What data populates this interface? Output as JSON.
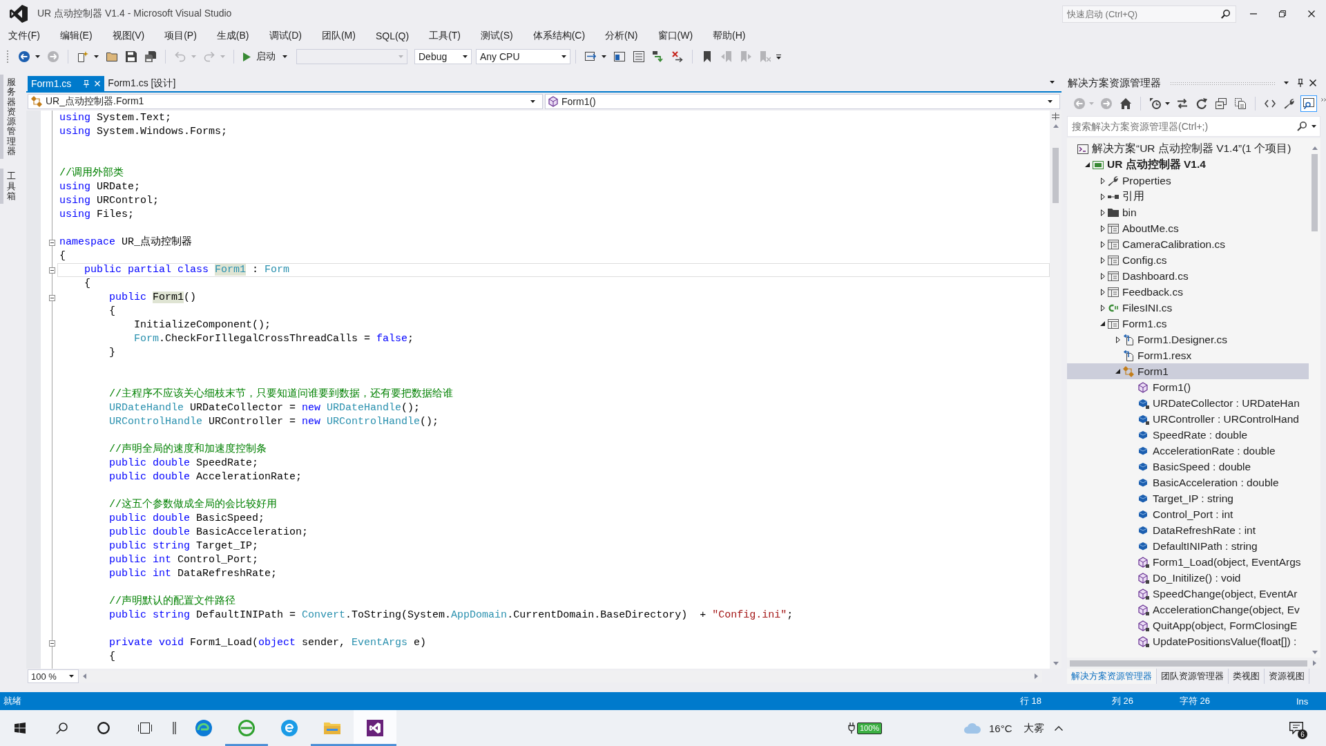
{
  "title_bar": {
    "title": "UR 点动控制器 V1.4 - Microsoft Visual Studio",
    "quick_launch": {
      "placeholder": "快速启动 (Ctrl+Q)"
    }
  },
  "menu": [
    "文件(F)",
    "编辑(E)",
    "视图(V)",
    "项目(P)",
    "生成(B)",
    "调试(D)",
    "团队(M)",
    "SQL(Q)",
    "工具(T)",
    "测试(S)",
    "体系结构(C)",
    "分析(N)",
    "窗口(W)",
    "帮助(H)"
  ],
  "toolbar": {
    "navigation_buttons": [
      {
        "kind": "back",
        "disabled": false
      },
      {
        "kind": "forward",
        "disabled": true
      }
    ],
    "file_buttons": [
      {
        "kind": "newproject",
        "disabled": false
      },
      {
        "kind": "open",
        "disabled": false
      },
      {
        "kind": "save",
        "disabled": false
      },
      {
        "kind": "saveall",
        "disabled": false
      }
    ],
    "edit_buttons": [
      {
        "kind": "undo",
        "disabled": true
      },
      {
        "kind": "redo",
        "disabled": true
      }
    ],
    "start_button": "启动",
    "configuration": "Debug",
    "platform": "Any CPU",
    "debug_buttons": [
      {
        "kind": "attach",
        "disabled": false
      },
      {
        "kind": "panel",
        "disabled": false
      },
      {
        "kind": "list",
        "disabled": false
      },
      {
        "kind": "stepin",
        "disabled": false
      },
      {
        "kind": "stepout",
        "disabled": false
      }
    ],
    "bookmark_buttons": [
      {
        "kind": "bookmark",
        "disabled": false
      },
      {
        "kind": "prevbookmark",
        "disabled": true
      },
      {
        "kind": "nextbookmark",
        "disabled": true
      },
      {
        "kind": "clearbookmark",
        "disabled": true
      }
    ]
  },
  "side_tabs": [
    "服务器资源管理器",
    "工具箱"
  ],
  "editor": {
    "tabs": [
      {
        "label": "Form1.cs",
        "selected": true
      },
      {
        "label": "Form1.cs [设计]",
        "selected": false
      }
    ],
    "type_dropdown": "UR_点动控制器.Form1",
    "member_dropdown": "Form1()",
    "lines": [
      {
        "fold": false,
        "current": false,
        "tokens": [
          {
            "text": "using",
            "kind": "keyword"
          },
          {
            "text": " System.Text;",
            "kind": "plain"
          }
        ]
      },
      {
        "fold": false,
        "current": false,
        "tokens": [
          {
            "text": "using",
            "kind": "keyword"
          },
          {
            "text": " System.Windows.Forms;",
            "kind": "plain"
          }
        ]
      },
      {
        "fold": false,
        "current": false
      },
      {
        "fold": false,
        "current": false
      },
      {
        "fold": false,
        "current": false,
        "tokens": [
          {
            "text": "//调用外部类",
            "kind": "comment"
          }
        ]
      },
      {
        "fold": false,
        "current": false,
        "tokens": [
          {
            "text": "using",
            "kind": "keyword"
          },
          {
            "text": " URDate;",
            "kind": "plain"
          }
        ]
      },
      {
        "fold": false,
        "current": false,
        "tokens": [
          {
            "text": "using",
            "kind": "keyword"
          },
          {
            "text": " URControl;",
            "kind": "plain"
          }
        ]
      },
      {
        "fold": false,
        "current": false,
        "tokens": [
          {
            "text": "using",
            "kind": "keyword"
          },
          {
            "text": " Files;",
            "kind": "plain"
          }
        ]
      },
      {
        "fold": false,
        "current": false
      },
      {
        "fold": true,
        "current": false,
        "tokens": [
          {
            "text": "namespace",
            "kind": "keyword"
          },
          {
            "text": " UR_点动控制器",
            "kind": "plain"
          }
        ]
      },
      {
        "fold": false,
        "current": false,
        "tokens": [
          {
            "text": "{",
            "kind": "plain"
          }
        ]
      },
      {
        "fold": true,
        "current": true,
        "tokens": [
          {
            "text": "    public partial class ",
            "kind": "keyword"
          },
          {
            "text": "Form1",
            "kind": "typematch"
          },
          {
            "text": " : ",
            "kind": "plain"
          },
          {
            "text": "Form",
            "kind": "type"
          }
        ]
      },
      {
        "fold": false,
        "current": false,
        "tokens": [
          {
            "text": "    {",
            "kind": "plain"
          }
        ]
      },
      {
        "fold": true,
        "current": false,
        "tokens": [
          {
            "text": "        public ",
            "kind": "keyword"
          },
          {
            "text": "Form1",
            "kind": "match"
          },
          {
            "text": "()",
            "kind": "plain"
          }
        ]
      },
      {
        "fold": false,
        "current": false,
        "tokens": [
          {
            "text": "        {",
            "kind": "plain"
          }
        ]
      },
      {
        "fold": false,
        "current": false,
        "tokens": [
          {
            "text": "            InitializeComponent();",
            "kind": "plain"
          }
        ]
      },
      {
        "fold": false,
        "current": false,
        "tokens": [
          {
            "text": "            Form",
            "kind": "type"
          },
          {
            "text": ".CheckForIllegalCrossThreadCalls = ",
            "kind": "plain"
          },
          {
            "text": "false",
            "kind": "keyword"
          },
          {
            "text": ";",
            "kind": "plain"
          }
        ]
      },
      {
        "fold": false,
        "current": false,
        "tokens": [
          {
            "text": "        }",
            "kind": "plain"
          }
        ]
      },
      {
        "fold": false,
        "current": false
      },
      {
        "fold": false,
        "current": false
      },
      {
        "fold": false,
        "current": false,
        "tokens": [
          {
            "text": "        //主程序不应该关心细枝末节，只要知道问谁要到数据，还有要把数据给谁",
            "kind": "comment"
          }
        ]
      },
      {
        "fold": false,
        "current": false,
        "tokens": [
          {
            "text": "        URDateHandle",
            "kind": "type"
          },
          {
            "text": " URDateCollector = ",
            "kind": "plain"
          },
          {
            "text": "new ",
            "kind": "keyword"
          },
          {
            "text": "URDateHandle",
            "kind": "type"
          },
          {
            "text": "();",
            "kind": "plain"
          }
        ]
      },
      {
        "fold": false,
        "current": false,
        "tokens": [
          {
            "text": "        URControlHandle",
            "kind": "type"
          },
          {
            "text": " URController = ",
            "kind": "plain"
          },
          {
            "text": "new ",
            "kind": "keyword"
          },
          {
            "text": "URControlHandle",
            "kind": "type"
          },
          {
            "text": "();",
            "kind": "plain"
          }
        ]
      },
      {
        "fold": false,
        "current": false
      },
      {
        "fold": false,
        "current": false,
        "tokens": [
          {
            "text": "        //声明全局的速度和加速度控制条",
            "kind": "comment"
          }
        ]
      },
      {
        "fold": false,
        "current": false,
        "tokens": [
          {
            "text": "        public double",
            "kind": "keyword"
          },
          {
            "text": " SpeedRate;",
            "kind": "plain"
          }
        ]
      },
      {
        "fold": false,
        "current": false,
        "tokens": [
          {
            "text": "        public double",
            "kind": "keyword"
          },
          {
            "text": " AccelerationRate;",
            "kind": "plain"
          }
        ]
      },
      {
        "fold": false,
        "current": false
      },
      {
        "fold": false,
        "current": false,
        "tokens": [
          {
            "text": "        //这五个参数做成全局的会比较好用",
            "kind": "comment"
          }
        ]
      },
      {
        "fold": false,
        "current": false,
        "tokens": [
          {
            "text": "        public double",
            "kind": "keyword"
          },
          {
            "text": " BasicSpeed;",
            "kind": "plain"
          }
        ]
      },
      {
        "fold": false,
        "current": false,
        "tokens": [
          {
            "text": "        public double",
            "kind": "keyword"
          },
          {
            "text": " BasicAcceleration;",
            "kind": "plain"
          }
        ]
      },
      {
        "fold": false,
        "current": false,
        "tokens": [
          {
            "text": "        public string",
            "kind": "keyword"
          },
          {
            "text": " Target_IP;",
            "kind": "plain"
          }
        ]
      },
      {
        "fold": false,
        "current": false,
        "tokens": [
          {
            "text": "        public int",
            "kind": "keyword"
          },
          {
            "text": " Control_Port;",
            "kind": "plain"
          }
        ]
      },
      {
        "fold": false,
        "current": false,
        "tokens": [
          {
            "text": "        public int",
            "kind": "keyword"
          },
          {
            "text": " DataRefreshRate;",
            "kind": "plain"
          }
        ]
      },
      {
        "fold": false,
        "current": false
      },
      {
        "fold": false,
        "current": false,
        "tokens": [
          {
            "text": "        //声明默认的配置文件路径",
            "kind": "comment"
          }
        ]
      },
      {
        "fold": false,
        "current": false,
        "tokens": [
          {
            "text": "        public string",
            "kind": "keyword"
          },
          {
            "text": " DefaultINIPath = ",
            "kind": "plain"
          },
          {
            "text": "Convert",
            "kind": "type"
          },
          {
            "text": ".ToString(System.",
            "kind": "plain"
          },
          {
            "text": "AppDomain",
            "kind": "type"
          },
          {
            "text": ".CurrentDomain.BaseDirectory)  + ",
            "kind": "plain"
          },
          {
            "text": "\"Config.ini\"",
            "kind": "string"
          },
          {
            "text": ";",
            "kind": "plain"
          }
        ]
      },
      {
        "fold": false,
        "current": false
      },
      {
        "fold": true,
        "current": false,
        "tokens": [
          {
            "text": "        private void",
            "kind": "keyword"
          },
          {
            "text": " Form1_Load(",
            "kind": "plain"
          },
          {
            "text": "object",
            "kind": "keyword"
          },
          {
            "text": " sender, ",
            "kind": "plain"
          },
          {
            "text": "EventArgs",
            "kind": "type"
          },
          {
            "text": " e)",
            "kind": "plain"
          }
        ]
      },
      {
        "fold": false,
        "current": false,
        "tokens": [
          {
            "text": "        {",
            "kind": "plain"
          }
        ]
      }
    ],
    "zoom": "100 %"
  },
  "solution_explorer": {
    "title": "解决方案资源管理器",
    "toolbar": {
      "navigation": [
        {
          "kind": "back",
          "disabled": true,
          "on": false
        },
        {
          "kind": "forward",
          "disabled": true,
          "on": false
        },
        {
          "kind": "home",
          "disabled": false,
          "on": false
        }
      ],
      "view": [
        {
          "kind": "history",
          "disabled": false,
          "on": false
        },
        {
          "kind": "sync",
          "disabled": false,
          "on": false
        },
        {
          "kind": "refresh",
          "disabled": false,
          "on": false
        },
        {
          "kind": "collapse",
          "disabled": false,
          "on": false
        },
        {
          "kind": "showall",
          "disabled": false,
          "on": false
        }
      ],
      "tools": [
        {
          "kind": "code",
          "disabled": false,
          "on": false
        },
        {
          "kind": "properties",
          "disabled": false,
          "on": false
        },
        {
          "kind": "preview",
          "disabled": false,
          "on": true
        }
      ]
    },
    "search": {
      "placeholder": "搜索解决方案资源管理器(Ctrl+;)"
    },
    "tree": [
      {
        "label": "解决方案“UR 点动控制器 V1.4”(1 个项目)",
        "kind": "solution",
        "selected": false,
        "children": [
          {
            "label": "UR 点动控制器 V1.4",
            "kind": "project",
            "expanded": true,
            "selected": false,
            "children": [
              {
                "label": "Properties",
                "kind": "properties",
                "expanded": false,
                "selected": false
              },
              {
                "label": "引用",
                "kind": "references",
                "expanded": false,
                "selected": false
              },
              {
                "label": "bin",
                "kind": "folder",
                "expanded": false,
                "selected": false
              },
              {
                "label": "AboutMe.cs",
                "kind": "form",
                "expanded": false,
                "selected": false
              },
              {
                "label": "CameraCalibration.cs",
                "kind": "form",
                "expanded": false,
                "selected": false
              },
              {
                "label": "Config.cs",
                "kind": "form",
                "expanded": false,
                "selected": false
              },
              {
                "label": "Dashboard.cs",
                "kind": "form",
                "expanded": false,
                "selected": false
              },
              {
                "label": "Feedback.cs",
                "kind": "form",
                "expanded": false,
                "selected": false
              },
              {
                "label": "FilesINI.cs",
                "kind": "csfile",
                "expanded": false,
                "selected": false
              },
              {
                "label": "Form1.cs",
                "kind": "form",
                "expanded": true,
                "selected": false,
                "children": [
                  {
                    "label": "Form1.Designer.cs",
                    "kind": "designer",
                    "expanded": false,
                    "selected": false
                  },
                  {
                    "label": "Form1.resx",
                    "kind": "resx",
                    "selected": false
                  },
                  {
                    "label": "Form1",
                    "kind": "class",
                    "expanded": true,
                    "selected": true,
                    "children": [
                      {
                        "label": "Form1()",
                        "kind": "method",
                        "selected": false
                      },
                      {
                        "label": "URDateCollector : URDateHan",
                        "kind": "privatefield",
                        "selected": false
                      },
                      {
                        "label": "URController : URControlHand",
                        "kind": "privatefield",
                        "selected": false
                      },
                      {
                        "label": "SpeedRate : double",
                        "kind": "field",
                        "selected": false
                      },
                      {
                        "label": "AccelerationRate : double",
                        "kind": "field",
                        "selected": false
                      },
                      {
                        "label": "BasicSpeed : double",
                        "kind": "field",
                        "selected": false
                      },
                      {
                        "label": "BasicAcceleration : double",
                        "kind": "field",
                        "selected": false
                      },
                      {
                        "label": "Target_IP : string",
                        "kind": "field",
                        "selected": false
                      },
                      {
                        "label": "Control_Port : int",
                        "kind": "field",
                        "selected": false
                      },
                      {
                        "label": "DataRefreshRate : int",
                        "kind": "field",
                        "selected": false
                      },
                      {
                        "label": "DefaultINIPath : string",
                        "kind": "field",
                        "selected": false
                      },
                      {
                        "label": "Form1_Load(object, EventArgs",
                        "kind": "privatemethod",
                        "selected": false
                      },
                      {
                        "label": "Do_Initilize() : void",
                        "kind": "privatemethod",
                        "selected": false
                      },
                      {
                        "label": "SpeedChange(object, EventAr",
                        "kind": "privatemethod",
                        "selected": false
                      },
                      {
                        "label": "AccelerationChange(object, Ev",
                        "kind": "privatemethod",
                        "selected": false
                      },
                      {
                        "label": "QuitApp(object, FormClosingE",
                        "kind": "privatemethod",
                        "selected": false
                      },
                      {
                        "label": "UpdatePositionsValue(float[]) :",
                        "kind": "privatemethod",
                        "selected": false
                      }
                    ]
                  }
                ]
              }
            ]
          }
        ]
      }
    ],
    "bottom_tabs": [
      {
        "label": "解决方案资源管理器",
        "selected": true
      },
      {
        "label": "团队资源管理器",
        "selected": false
      },
      {
        "label": "类视图",
        "selected": false
      },
      {
        "label": "资源视图",
        "selected": false
      }
    ]
  },
  "status_bar": {
    "message": "就绪",
    "line": "行 18",
    "column": "列 26",
    "character": "字符 26",
    "mode": "Ins"
  },
  "taskbar": {
    "apps": [
      {
        "kind": "edge",
        "running": false,
        "selected": false
      },
      {
        "kind": "greenbrowser",
        "running": true,
        "selected": false
      },
      {
        "kind": "bluebrowser",
        "running": false,
        "selected": false
      },
      {
        "kind": "folder",
        "running": true,
        "selected": false
      },
      {
        "kind": "studio",
        "running": true,
        "selected": true
      }
    ],
    "battery": "100%",
    "temperature": "16°C",
    "weather": "大雾",
    "notifications": "6"
  }
}
